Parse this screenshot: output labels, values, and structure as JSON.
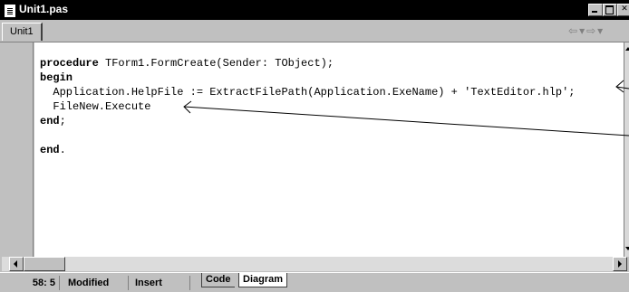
{
  "window": {
    "title": "Unit1.pas",
    "icon": "document-icon"
  },
  "tabs": [
    {
      "label": "Unit1"
    }
  ],
  "code": {
    "lines": [
      {
        "kw": "procedure",
        "rest": " TForm1.FormCreate(Sender: TObject);"
      },
      {
        "kw": "begin",
        "rest": ""
      },
      {
        "kw": "",
        "rest": "  Application.HelpFile := ExtractFilePath(Application.ExeName) + 'TextEditor.hlp';"
      },
      {
        "kw": "",
        "rest": "  FileNew.Execute"
      },
      {
        "kw": "end",
        "rest": ";"
      },
      {
        "kw": "",
        "rest": ""
      },
      {
        "kw": "end",
        "rest": "."
      }
    ]
  },
  "status": {
    "position": "58:  5",
    "modified": "Modified",
    "insert_mode": "Insert"
  },
  "view_tabs": {
    "code": "Code",
    "diagram": "Diagram"
  },
  "colors": {
    "titlebar": "#000000",
    "chrome": "#c0c0c0",
    "editor_bg": "#ffffff"
  }
}
